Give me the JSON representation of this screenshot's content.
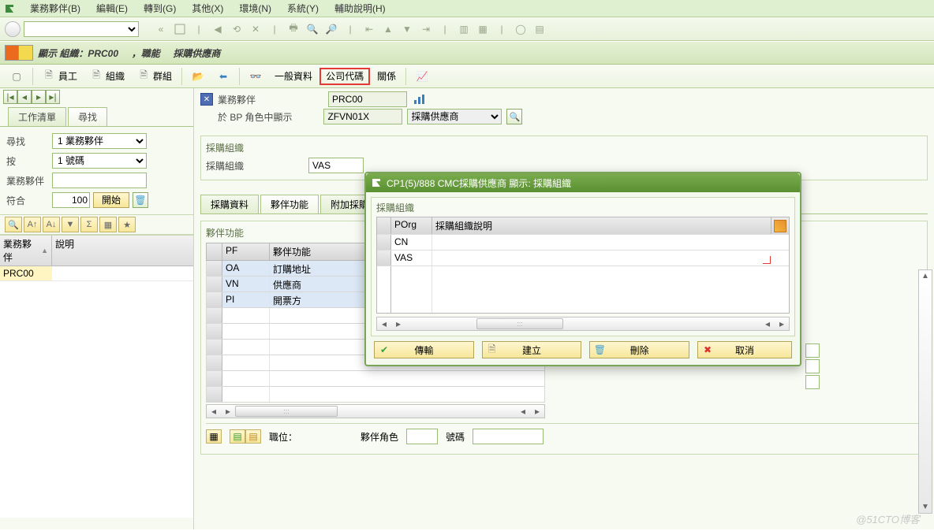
{
  "menubar": {
    "items": [
      "業務夥伴(B)",
      "編輯(E)",
      "轉到(G)",
      "其他(X)",
      "環境(N)",
      "系統(Y)",
      "輔助說明(H)"
    ]
  },
  "title": {
    "prefix": "顯示 組織：",
    "bp": "PRC00",
    "mid": "，職能",
    "suffix": "採購供應商"
  },
  "tbar2": {
    "employee": "員工",
    "organization": "組織",
    "group": "群組",
    "general": "一般資料",
    "company": "公司代碼",
    "relation": "關係"
  },
  "bpHeader": {
    "bpLabel": "業務夥伴",
    "bpValue": "PRC00",
    "roleLabel": "於 BP 角色中顯示",
    "roleCode": "ZFVN01X",
    "roleText": "採購供應商"
  },
  "leftTabs": {
    "worklist": "工作清單",
    "find": "尋找"
  },
  "search": {
    "findLabel": "尋找",
    "findOption": "1 業務夥伴",
    "byLabel": "按",
    "byOption": "1 號碼",
    "bpLabel": "業務夥伴",
    "bpValue": "",
    "maxLabel": "符合",
    "maxValue": "100",
    "start": "開始"
  },
  "resultHdr": {
    "col1": "業務夥伴",
    "col2": "說明"
  },
  "resultRow": {
    "col1": "PRC00",
    "col2": ""
  },
  "purchGroup": {
    "title": "採購組織",
    "fieldLabel": "採購組織",
    "fieldValue": "VAS"
  },
  "subtabs": {
    "purchData": "採購資料",
    "partnerFunc": "夥伴功能",
    "addPurch": "附加採購資"
  },
  "pf": {
    "title": "夥伴功能",
    "colPF": "PF",
    "colDesc": "夥伴功能",
    "rows": [
      {
        "pf": "OA",
        "desc": "訂購地址"
      },
      {
        "pf": "VN",
        "desc": "供應商"
      },
      {
        "pf": "PI",
        "desc": "開票方"
      }
    ]
  },
  "bottom": {
    "position": "職位：",
    "partnerRole": "夥伴角色",
    "number": "號碼"
  },
  "popup": {
    "title": "CP1(5)/888 CMC採購供應商 顯示: 採購組織",
    "groupTitle": "採購組織",
    "colPOrg": "POrg",
    "colDesc": "採購組織說明",
    "rows": [
      {
        "porg": "CN",
        "desc": ""
      },
      {
        "porg": "VAS",
        "desc": ""
      }
    ],
    "btnTransfer": "傳輸",
    "btnCreate": "建立",
    "btnDelete": "刪除",
    "btnCancel": "取消"
  },
  "watermark": "@51CTO博客"
}
